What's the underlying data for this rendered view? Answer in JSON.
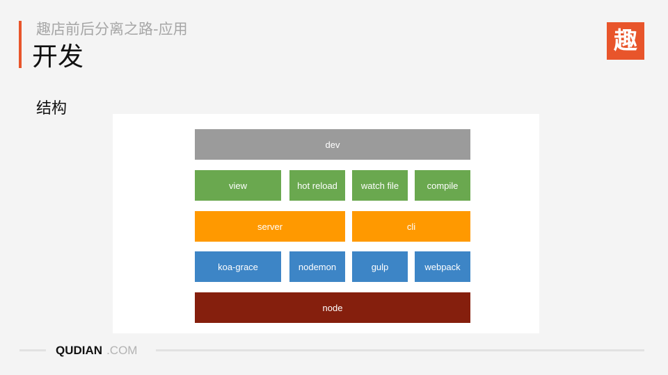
{
  "header": {
    "subtitle": "趣店前后分离之路-应用",
    "title": "开发",
    "logo_text": "趣",
    "accent_color": "#e8552b"
  },
  "section": {
    "label": "结构"
  },
  "diagram": {
    "dev": "dev",
    "view": "view",
    "hot_reload": "hot reload",
    "watch_file": "watch file",
    "compile": "compile",
    "server": "server",
    "cli": "cli",
    "koa_grace": "koa-grace",
    "nodemon": "nodemon",
    "gulp": "gulp",
    "webpack": "webpack",
    "node": "node",
    "colors": {
      "dev": "#9b9b9b",
      "tools": "#6aa84f",
      "runtime": "#ff9900",
      "packages": "#3d85c6",
      "base": "#851f0d"
    }
  },
  "footer": {
    "brand": "QUDIAN",
    "suffix": ".COM"
  }
}
